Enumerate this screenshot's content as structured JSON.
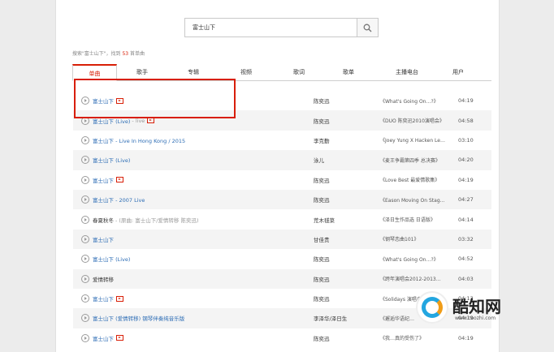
{
  "search": {
    "query": "富士山下"
  },
  "summary": {
    "prefix": "搜索\"富士山下\"，找到",
    "count": "53",
    "suffix": "首单曲"
  },
  "tabs": [
    "单曲",
    "歌手",
    "专辑",
    "视频",
    "歌词",
    "歌单",
    "主播电台",
    "用户"
  ],
  "songs": [
    {
      "title": "富士山下",
      "extra": "",
      "mv": true,
      "singer": "陈奕迅",
      "album": "《What's Going On…?》",
      "duration": "04:19"
    },
    {
      "title": "富士山下 (Live)",
      "extra": "- live",
      "mv": true,
      "singer": "陈奕迅",
      "album": "《DUO 陈奕迅2010演唱会》",
      "duration": "04:58"
    },
    {
      "title": "富士山下 - Live In Hong Kong / 2015",
      "extra": "",
      "mv": false,
      "singer": "李克勤",
      "album": "《Joey Yung X Hacken Le…",
      "duration": "03:10"
    },
    {
      "title": "富士山下 (Live)",
      "extra": "",
      "mv": false,
      "singer": "泳儿",
      "album": "《麦王争霸第四季 总决赛》",
      "duration": "04:20"
    },
    {
      "title": "富士山下",
      "extra": "",
      "mv": true,
      "singer": "陈奕迅",
      "album": "《Love Best 最爱情歌集》",
      "duration": "04:19"
    },
    {
      "title": "富士山下 - 2007 Live",
      "extra": "",
      "mv": false,
      "singer": "陈奕迅",
      "album": "《Eason Moving On Stag…",
      "duration": "04:27"
    },
    {
      "title": "春夏秋冬",
      "extra": "- (原曲: 富士山下/爱情转移 陈奕迅)",
      "mv": false,
      "singer": "荒木毬菜",
      "album": "《泽日生作品选 日语版》",
      "duration": "04:14"
    },
    {
      "title": "富士山下",
      "extra": "",
      "mv": false,
      "singer": "甘佳贵",
      "album": "《钢琴恋曲101》",
      "duration": "03:32"
    },
    {
      "title": "富士山下 (Live)",
      "extra": "",
      "mv": false,
      "singer": "陈奕迅",
      "album": "《What's Going On…?》",
      "duration": "04:52"
    },
    {
      "title": "爱情转移",
      "extra": "",
      "mv": false,
      "singer": "陈奕迅",
      "album": "《跨年演唱会2012-2013…",
      "duration": "04:03"
    },
    {
      "title": "富士山下",
      "extra": "",
      "mv": true,
      "singer": "陈奕迅",
      "album": "《Solidays 演唱会》",
      "duration": "04:13"
    },
    {
      "title": "富士山下 (爱情转移) 钢琴伴奏纯音乐版",
      "extra": "",
      "mv": false,
      "singer": "李泽华/泽日生",
      "album": "《邂逅华语纪…",
      "duration": "04:19"
    },
    {
      "title": "富士山下",
      "extra": "",
      "mv": true,
      "singer": "陈奕迅",
      "album": "《我…真的受伤了》",
      "duration": "04:19"
    }
  ],
  "watermark": {
    "title": "酷知网",
    "url": "www.coozhi.com"
  },
  "colors": {
    "accent": "#d81e06",
    "link": "#2d6db5"
  },
  "icons": {
    "search": "search-icon",
    "play": "play-icon",
    "mv": "mv-icon"
  }
}
